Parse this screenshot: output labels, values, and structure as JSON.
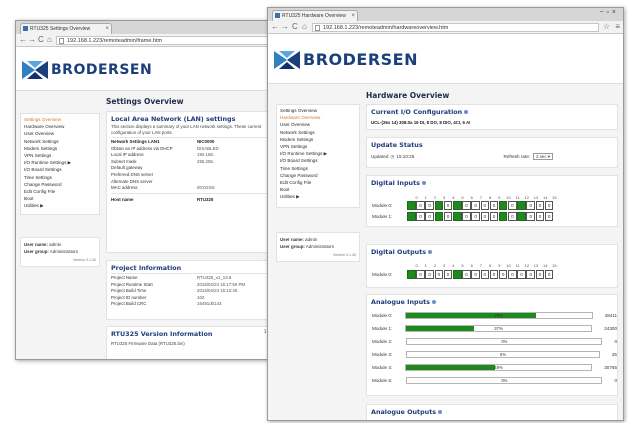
{
  "back_window": {
    "tab_title": "RTU325 Settings Overview",
    "url": "192.168.1.223/remoteadmin/frame.htm",
    "logo_text": "BRODERSEN",
    "page_title": "Settings Overview",
    "sidebar": [
      {
        "label": "Settings Overview",
        "active": true
      },
      {
        "label": "Hardware Overview",
        "active": false
      },
      {
        "label": "User Overview",
        "active": false
      },
      {
        "label": "Network Settings",
        "active": false
      },
      {
        "label": "Modem Settings",
        "active": false
      },
      {
        "label": "VPN Settings",
        "active": false
      },
      {
        "label": "I/O Runtime Settings ▶",
        "active": false
      },
      {
        "label": "I/O Board Settings",
        "active": false
      },
      {
        "label": "Time Settings",
        "active": false
      },
      {
        "label": "Change Password",
        "active": false
      },
      {
        "label": "Edit Config File",
        "active": false
      },
      {
        "label": "Boot",
        "active": false
      },
      {
        "label": "Utilities ▶",
        "active": false
      }
    ],
    "user": {
      "name_label": "User name:",
      "name": "admin",
      "group_label": "User group:",
      "group": "Administrators",
      "version": "Version 0.1.40"
    },
    "lan": {
      "heading": "Local Area Network (LAN) settings",
      "desc": "This section displays a summary of your LAN network settings. These current configuration of your LAN ports.",
      "rows": [
        {
          "k": "Network Settings LAN1",
          "v": "NIC0000",
          "bold": true
        },
        {
          "k": "Obtain an IP address via DHCP",
          "v": "DISABLED",
          "bold": false
        },
        {
          "k": "Local IP address",
          "v": "192.168.",
          "bold": false
        },
        {
          "k": "Subnet mask",
          "v": "255.255.",
          "bold": false
        },
        {
          "k": "Default gateway",
          "v": "",
          "bold": false
        },
        {
          "k": "Preferred DNS server",
          "v": "",
          "bold": false
        },
        {
          "k": "Alternate DNS server",
          "v": "",
          "bold": false
        },
        {
          "k": "MAC address",
          "v": "00:04:E6",
          "bold": false
        }
      ],
      "host_label": "Host name",
      "host_value": "RTU325"
    },
    "project": {
      "heading": "Project Information",
      "rows": [
        {
          "k": "Project Name",
          "v": "RTU325_v1_13.5"
        },
        {
          "k": "Project Runtime Start",
          "v": "2015/04/24 16:17:56 PM"
        },
        {
          "k": "Project Build Time",
          "v": "2015/04/23 15:12:45"
        },
        {
          "k": "Project ID number",
          "v": "102"
        },
        {
          "k": "Project Build CRC",
          "v": "16491d0143"
        }
      ]
    },
    "version_panel": {
      "heading": "RTU325 Version Information",
      "line": "RTU325 Firmware Data (RTU325.bin)",
      "right": "1.4"
    }
  },
  "front_window": {
    "tab_title": "RTU325 Hardware Overview",
    "url": "192.168.1.223/remoteadmin/hardwareoverview.htm",
    "logo_text": "BRODERSEN",
    "page_title": "Hardware Overview",
    "sidebar": [
      {
        "label": "Settings Overview",
        "active": false
      },
      {
        "label": "Hardware Overview",
        "active": true
      },
      {
        "label": "User Overview",
        "active": false
      },
      {
        "label": "Network Settings",
        "active": false
      },
      {
        "label": "Modem Settings",
        "active": false
      },
      {
        "label": "VPN Settings",
        "active": false
      },
      {
        "label": "I/O Runtime Settings ▶",
        "active": false
      },
      {
        "label": "I/O Board Settings",
        "active": false
      },
      {
        "label": "Time Settings",
        "active": false
      },
      {
        "label": "Change Password",
        "active": false
      },
      {
        "label": "Edit Config File",
        "active": false
      },
      {
        "label": "Boot",
        "active": false
      },
      {
        "label": "Utilities ▶",
        "active": false
      }
    ],
    "user": {
      "name_label": "User name:",
      "name": "admin",
      "group_label": "User group:",
      "group": "Administrators",
      "version": "Version 0.1.40"
    },
    "io_config": {
      "heading": "Current I/O Configuration",
      "text": "UCL-(26x 14) 308.0a 16 DI, 8 DO, 8 DIO, 4CI, 6 AI"
    },
    "update_status": {
      "heading": "Update Status",
      "updated_label": "Updated",
      "updated_time": "15:10:25",
      "refresh_label": "Refresh rate:",
      "refresh_value": "2 sec"
    },
    "channel_numbers": [
      "0",
      "1",
      "2",
      "3",
      "4",
      "5",
      "6",
      "7",
      "8",
      "9",
      "10",
      "11",
      "12",
      "13",
      "14",
      "15"
    ],
    "digital_inputs": {
      "heading": "Digital Inputs",
      "modules": [
        {
          "label": "Module 0:",
          "bits": [
            1,
            0,
            0,
            1,
            0,
            1,
            0,
            0,
            0,
            0,
            1,
            0,
            1,
            0,
            0,
            0
          ]
        },
        {
          "label": "Module 1:",
          "bits": [
            1,
            0,
            0,
            1,
            0,
            1,
            0,
            0,
            0,
            0,
            1,
            0,
            1,
            0,
            0,
            0
          ]
        }
      ]
    },
    "digital_outputs": {
      "heading": "Digital Outputs",
      "modules": [
        {
          "label": "Module 0:",
          "bits": [
            1,
            0,
            0,
            0,
            0,
            1,
            0,
            0,
            0,
            0,
            0,
            0,
            0,
            0,
            0,
            0
          ]
        }
      ]
    },
    "analogue_inputs": {
      "heading": "Analogue Inputs",
      "modules": [
        {
          "label": "Module 0:",
          "percent": 70,
          "pct_text": "70%",
          "value": "49411"
        },
        {
          "label": "Module 1:",
          "percent": 37,
          "pct_text": "37%",
          "value": "24300"
        },
        {
          "label": "Module 2:",
          "percent": 0,
          "pct_text": "0%",
          "value": "0"
        },
        {
          "label": "Module 3:",
          "percent": 0,
          "pct_text": "0%",
          "value": "25"
        },
        {
          "label": "Module 4:",
          "percent": 48,
          "pct_text": "48%",
          "value": "30765"
        },
        {
          "label": "Module 5:",
          "percent": 0,
          "pct_text": "0%",
          "value": "0"
        }
      ]
    },
    "analogue_outputs": {
      "heading": "Analogue Outputs"
    }
  },
  "colors": {
    "brand_blue": "#1b3f7a",
    "active_link": "#d9742b",
    "on_green": "#1e8a1e"
  }
}
